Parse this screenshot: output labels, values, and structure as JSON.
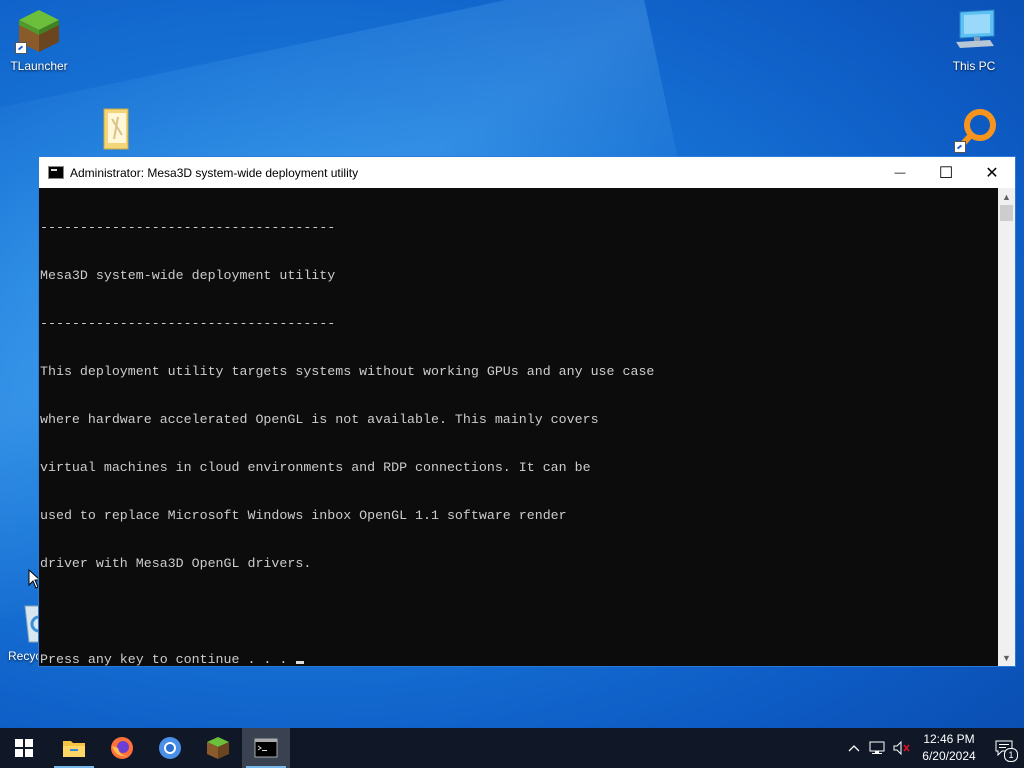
{
  "desktop": {
    "icons": [
      {
        "label": "TLauncher",
        "icon": "minecraft-grass-block"
      },
      {
        "label": "",
        "icon": "folder"
      },
      {
        "label": "This PC",
        "icon": "computer-monitor"
      },
      {
        "label": "",
        "icon": "orange-key"
      },
      {
        "label": "Recyc",
        "icon": "recycle-bin"
      }
    ]
  },
  "window": {
    "title": "Administrator:  Mesa3D system-wide deployment utility",
    "controls": {
      "minimize": "—",
      "maximize": "☐",
      "close": "✕"
    },
    "console_lines": [
      "-------------------------------------",
      "Mesa3D system-wide deployment utility",
      "-------------------------------------",
      "This deployment utility targets systems without working GPUs and any use case",
      "where hardware accelerated OpenGL is not available. This mainly covers",
      "virtual machines in cloud environments and RDP connections. It can be",
      "used to replace Microsoft Windows inbox OpenGL 1.1 software render",
      "driver with Mesa3D OpenGL drivers.",
      ""
    ],
    "prompt": "Press any key to continue . . . "
  },
  "taskbar": {
    "apps": [
      {
        "name": "Start",
        "icon": "windows-logo"
      },
      {
        "name": "File Explorer",
        "icon": "folder"
      },
      {
        "name": "Firefox",
        "icon": "firefox"
      },
      {
        "name": "Chrome",
        "icon": "chrome"
      },
      {
        "name": "TLauncher",
        "icon": "minecraft-grass-block"
      },
      {
        "name": "Command Prompt",
        "icon": "console"
      }
    ],
    "clock": {
      "time": "12:46 PM",
      "date": "6/20/2024"
    },
    "notifications_count": "1"
  },
  "colors": {
    "console_bg": "#0c0c0c",
    "console_fg": "#cccccc",
    "accent": "#2b78d8",
    "taskbar": "#101827"
  }
}
